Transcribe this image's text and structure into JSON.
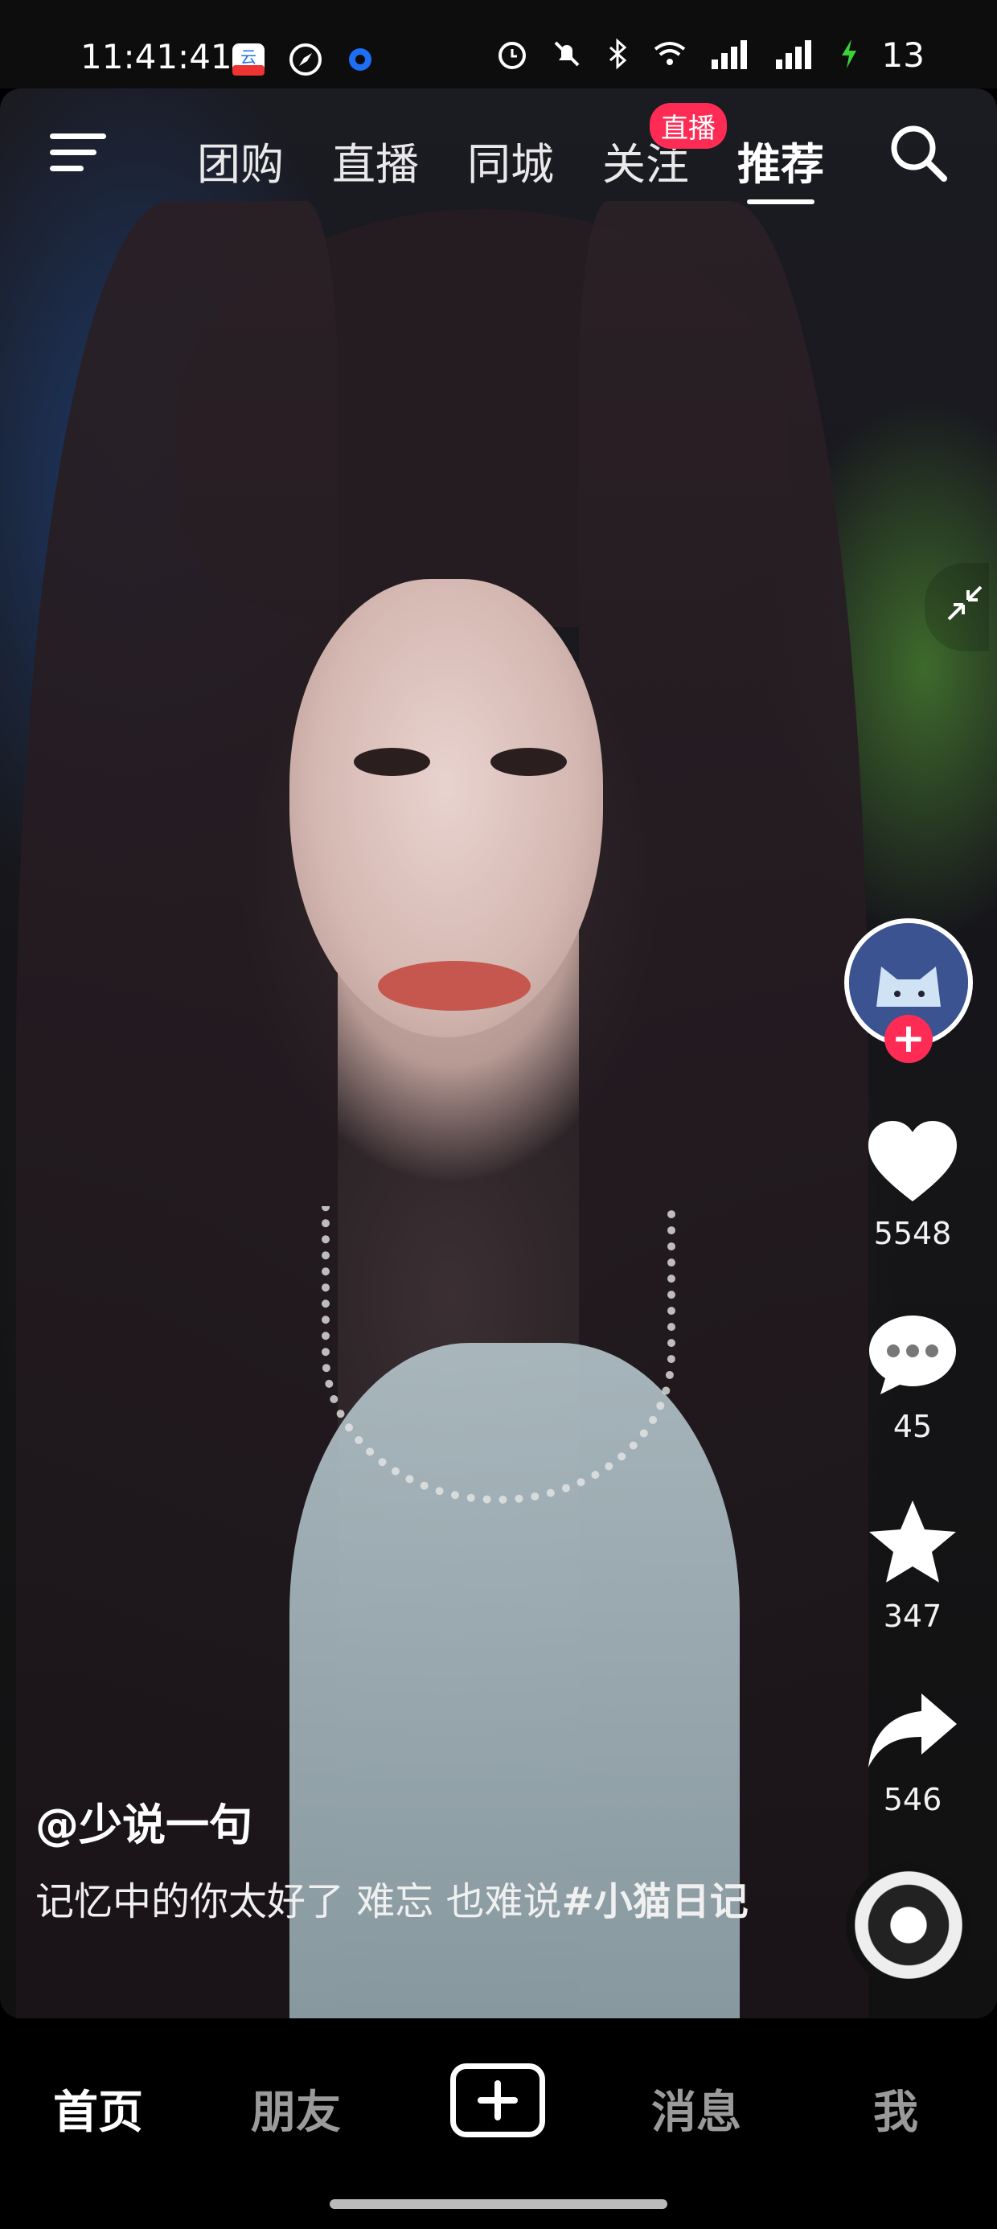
{
  "status_bar": {
    "time": "11:41:41",
    "battery": "13",
    "icons": [
      "cloud-app-icon",
      "compass-icon",
      "circle-app-icon",
      "alarm-icon",
      "mute-icon",
      "bluetooth-icon",
      "wifi-icon",
      "signal-icon",
      "signal-icon",
      "charging-icon"
    ]
  },
  "top_nav": {
    "tabs": [
      "团购",
      "直播",
      "同城",
      "关注",
      "推荐"
    ],
    "active_tab": "推荐",
    "live_badge": "直播"
  },
  "video": {
    "author": "@少说一句",
    "description": "记忆中的你太好了 难忘 也难说",
    "hashtag": "#小猫日记"
  },
  "actions": {
    "likes": "5548",
    "comments": "45",
    "favorites": "347",
    "shares": "546",
    "follow_label": "+"
  },
  "bottom_nav": {
    "home": "首页",
    "friends": "朋友",
    "messages": "消息",
    "me": "我"
  },
  "colors": {
    "accent": "#fe2c55",
    "background": "#000000"
  }
}
